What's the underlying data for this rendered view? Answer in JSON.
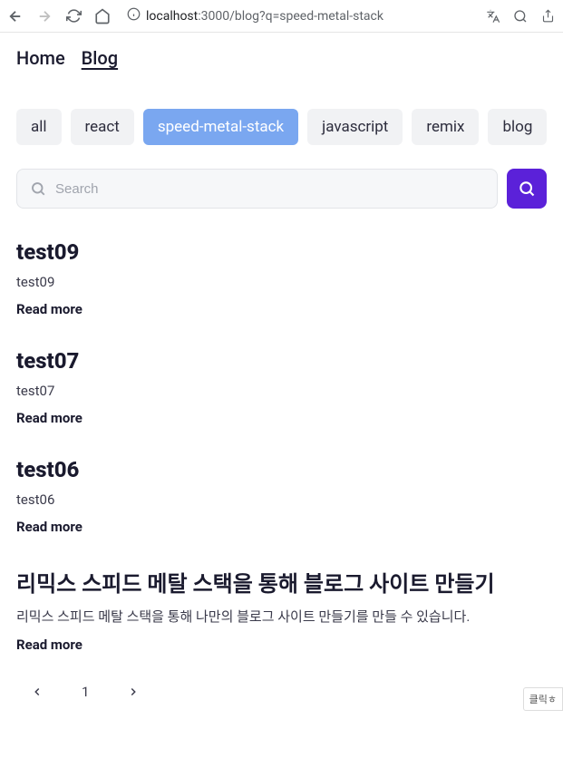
{
  "browser": {
    "url_host": "localhost",
    "url_port_path": ":3000/blog?q=speed-metal-stack"
  },
  "nav": {
    "home": "Home",
    "blog": "Blog"
  },
  "tags": [
    {
      "label": "all",
      "active": false
    },
    {
      "label": "react",
      "active": false
    },
    {
      "label": "speed-metal-stack",
      "active": true
    },
    {
      "label": "javascript",
      "active": false
    },
    {
      "label": "remix",
      "active": false
    },
    {
      "label": "blog",
      "active": false
    }
  ],
  "search": {
    "placeholder": "Search"
  },
  "posts": [
    {
      "title": "test09",
      "excerpt": "test09",
      "read_more": "Read more"
    },
    {
      "title": "test07",
      "excerpt": "test07",
      "read_more": "Read more"
    },
    {
      "title": "test06",
      "excerpt": "test06",
      "read_more": "Read more"
    },
    {
      "title": "리믹스 스피드 메탈 스택을 통해 블로그 사이트 만들기",
      "excerpt": "리믹스 스피드 메탈 스택을 통해 나만의 블로그 사이트 만들기를 만들 수 있습니다.",
      "read_more": "Read more"
    }
  ],
  "pagination": {
    "current": "1"
  },
  "floating_badge": "클릭ㅎ"
}
